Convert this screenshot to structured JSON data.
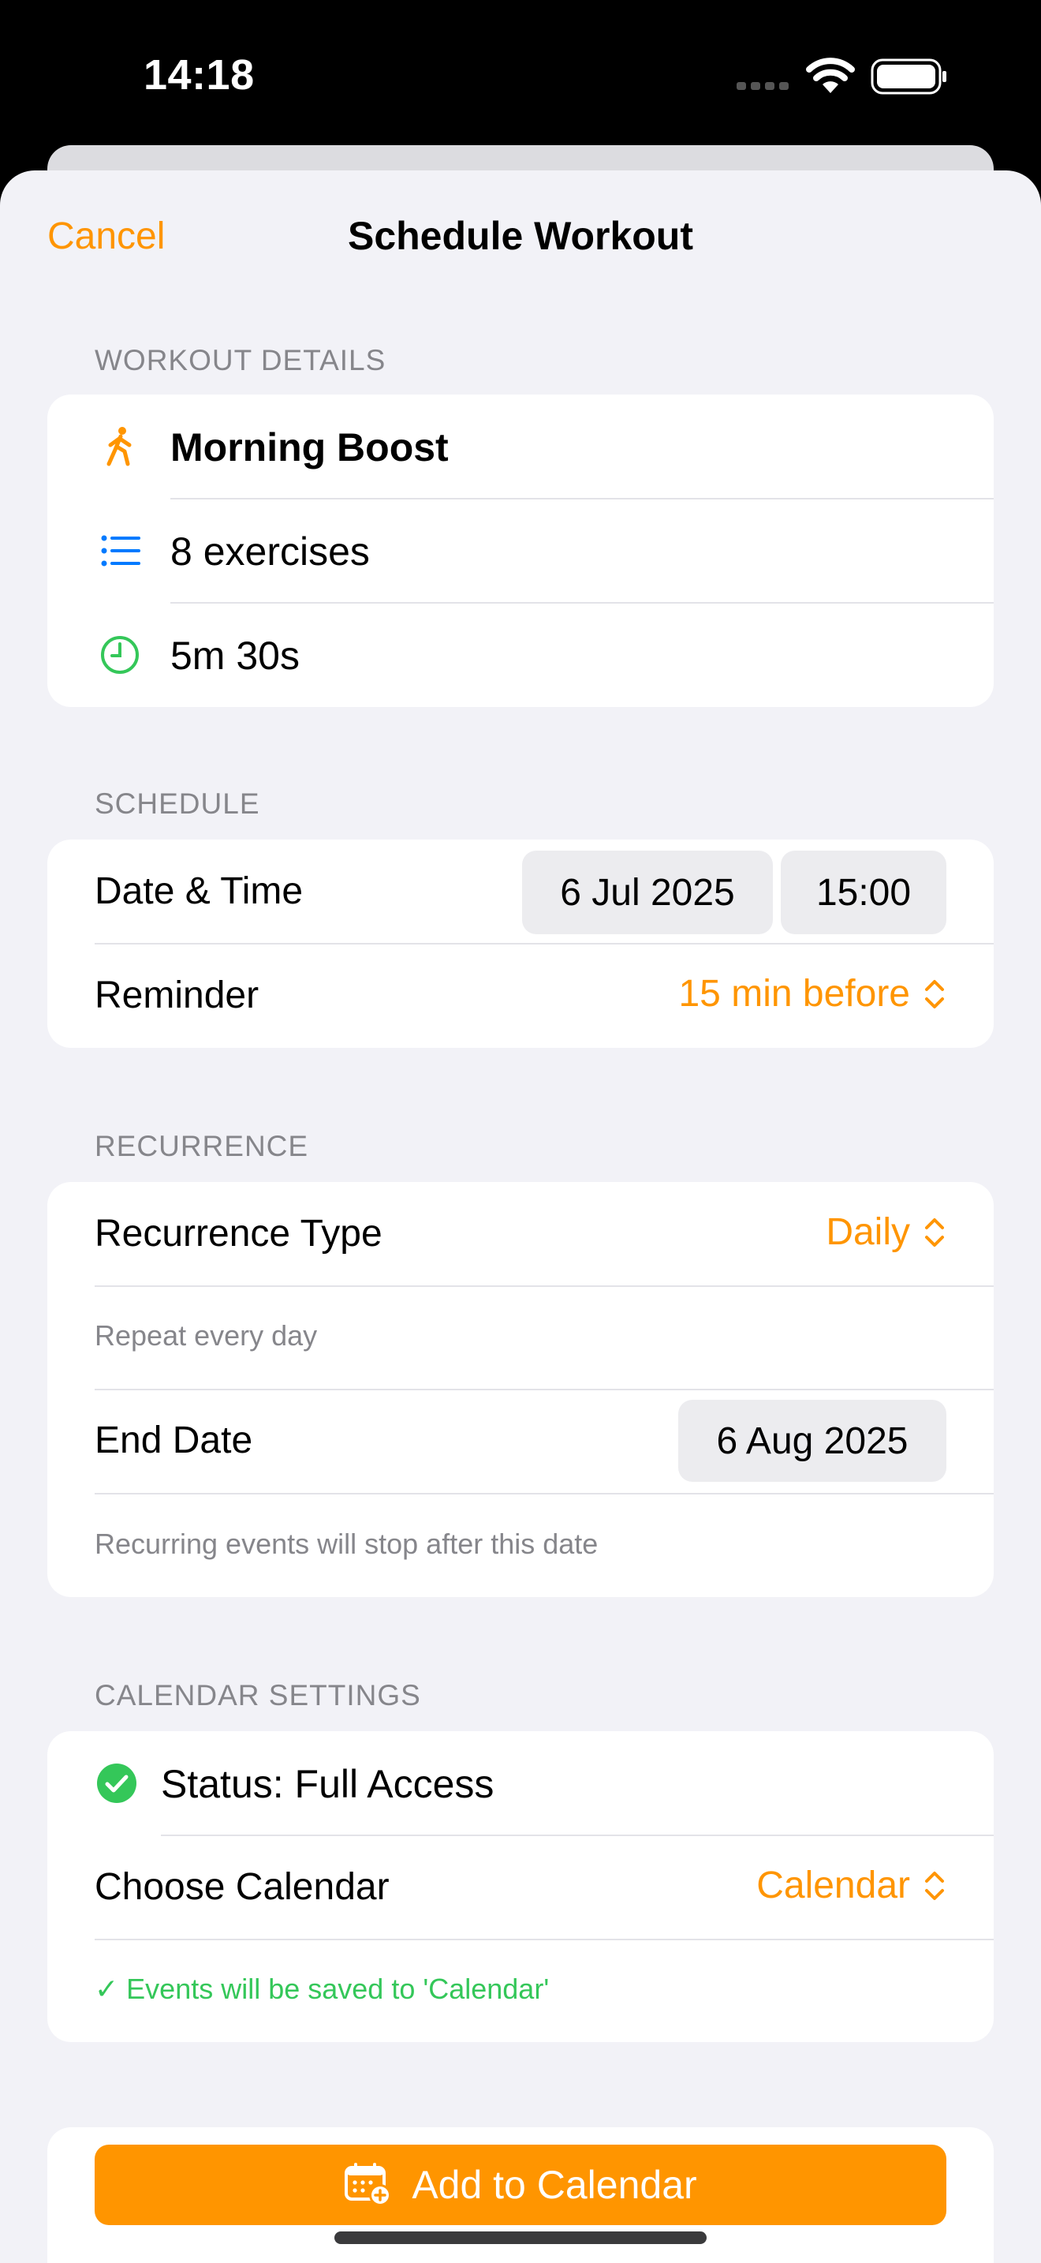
{
  "status_bar": {
    "time": "14:18"
  },
  "nav": {
    "cancel": "Cancel",
    "title": "Schedule Workout"
  },
  "workout_details": {
    "header": "WORKOUT DETAILS",
    "name": "Morning Boost",
    "exercises": "8 exercises",
    "duration": "5m 30s"
  },
  "schedule": {
    "header": "SCHEDULE",
    "date_time_label": "Date & Time",
    "date": "6 Jul 2025",
    "time": "15:00",
    "reminder_label": "Reminder",
    "reminder_value": "15 min before"
  },
  "recurrence": {
    "header": "RECURRENCE",
    "type_label": "Recurrence Type",
    "type_value": "Daily",
    "type_note": "Repeat every day",
    "end_label": "End Date",
    "end_value": "6 Aug 2025",
    "end_note": "Recurring events will stop after this date"
  },
  "calendar_settings": {
    "header": "CALENDAR SETTINGS",
    "status": "Status: Full Access",
    "choose_label": "Choose Calendar",
    "choose_value": "Calendar",
    "confirmation": "✓ Events will be saved to 'Calendar'"
  },
  "action": {
    "add_to_calendar": "Add to Calendar"
  },
  "colors": {
    "accent": "#ff9500",
    "success": "#34c759",
    "blue": "#007aff",
    "background": "#f2f2f7"
  }
}
